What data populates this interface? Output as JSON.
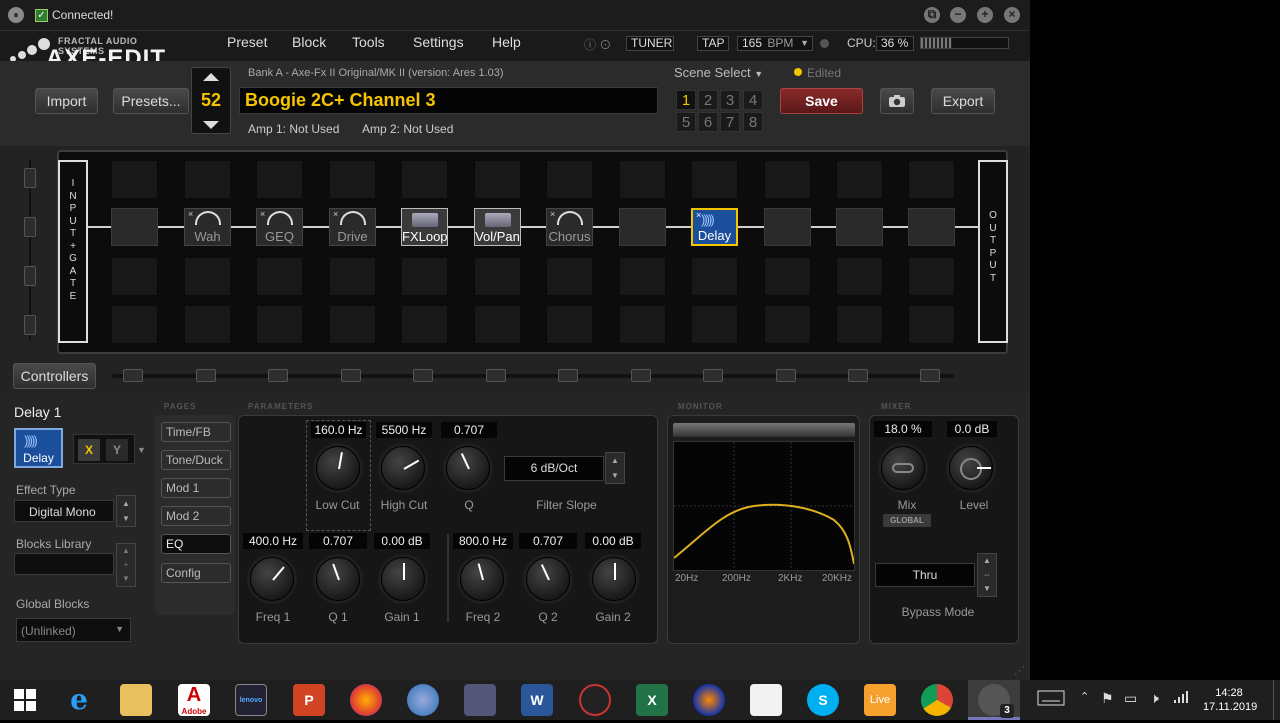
{
  "titlebar": {
    "status": "Connected!",
    "check": "✓",
    "pause_icon": "⏸",
    "restore_icon": "⧉",
    "minimize_icon": "−",
    "maximize_icon": "+",
    "close_icon": "×"
  },
  "logo": {
    "company": "FRACTAL AUDIO SYSTEMS",
    "product": "AXE-EDIT"
  },
  "menu": [
    "Preset",
    "Block",
    "Tools",
    "Settings",
    "Help"
  ],
  "header": {
    "tuner": "TUNER",
    "tap": "TAP",
    "bpm_value": "165",
    "bpm_unit": "BPM",
    "cpu_label": "CPU:",
    "cpu_value": "36 %",
    "cpu_fraction": 0.36
  },
  "toolbar": {
    "import": "Import",
    "presets": "Presets...",
    "save": "Save",
    "export": "Export",
    "preset_number": "52",
    "bank_info": "Bank A - Axe-Fx II Original/MK II (version: Ares 1.03)",
    "preset_name": "Boogie 2C+ Channel 3",
    "amp1": "Amp 1: Not Used",
    "amp2": "Amp 2: Not Used",
    "scene_select": "Scene Select",
    "edited": "Edited",
    "scenes": [
      "1",
      "2",
      "3",
      "4",
      "5",
      "6",
      "7",
      "8"
    ],
    "active_scene": "1",
    "camera_icon": "camera-icon"
  },
  "grid": {
    "input_label": [
      "I",
      "N",
      "P",
      "U",
      "T",
      "+",
      "G",
      "A",
      "T",
      "E"
    ],
    "output_label": [
      "O",
      "U",
      "T",
      "P",
      "U",
      "T"
    ],
    "blocks": [
      {
        "label": "Wah",
        "state": "bypass"
      },
      {
        "label": "GEQ",
        "state": "bypass"
      },
      {
        "label": "Drive",
        "state": "bypass"
      },
      {
        "label": "FXLoop",
        "state": "on"
      },
      {
        "label": "Vol/Pan",
        "state": "on"
      },
      {
        "label": "Chorus",
        "state": "bypass"
      },
      {
        "label": "Delay",
        "state": "selected"
      }
    ]
  },
  "controllers": {
    "label": "Controllers"
  },
  "block_panel": {
    "title": "Delay 1",
    "icon_label": "Delay",
    "x": "X",
    "y": "Y",
    "effect_type_label": "Effect Type",
    "effect_type": "Digital Mono",
    "blocks_library_label": "Blocks Library",
    "global_blocks_label": "Global Blocks",
    "global_blocks_value": "(Unlinked)"
  },
  "sections": {
    "pages": "PAGES",
    "parameters": "PARAMETERS",
    "monitor": "MONITOR",
    "mixer": "MIXER"
  },
  "pages": [
    "Time/FB",
    "Tone/Duck",
    "Mod 1",
    "Mod 2",
    "EQ",
    "Config"
  ],
  "active_page": "EQ",
  "params": {
    "low_cut": {
      "value": "160.0 Hz",
      "label": "Low Cut"
    },
    "high_cut": {
      "value": "5500 Hz",
      "label": "High Cut"
    },
    "q": {
      "value": "0.707",
      "label": "Q"
    },
    "filter_slope": {
      "value": "6 dB/Oct",
      "label": "Filter Slope"
    },
    "freq1": {
      "value": "400.0 Hz",
      "label": "Freq 1"
    },
    "q1": {
      "value": "0.707",
      "label": "Q 1"
    },
    "gain1": {
      "value": "0.00 dB",
      "label": "Gain 1"
    },
    "freq2": {
      "value": "800.0 Hz",
      "label": "Freq 2"
    },
    "q2": {
      "value": "0.707",
      "label": "Q 2"
    },
    "gain2": {
      "value": "0.00 dB",
      "label": "Gain 2"
    }
  },
  "monitor": {
    "axis": [
      "20Hz",
      "200Hz",
      "2KHz",
      "20KHz"
    ],
    "curve_color": "#e0b020"
  },
  "mixer": {
    "mix": {
      "value": "18.0 %",
      "label": "Mix",
      "badge": "GLOBAL"
    },
    "level": {
      "value": "0.0 dB",
      "label": "Level"
    },
    "bypass_mode": {
      "value": "Thru",
      "label": "Bypass Mode"
    }
  },
  "taskbar": {
    "apps": [
      "windows-start-icon",
      "internet-explorer-icon",
      "file-explorer-icon",
      "adobe-icon",
      "lenovo-icon",
      "powerpoint-icon",
      "firefox-icon",
      "thunderbird-icon",
      "network-app-icon",
      "word-icon",
      "guitar-pro-icon",
      "excel-icon",
      "audacity-icon",
      "blank-file-icon",
      "skype-icon",
      "live-icon",
      "chrome-icon",
      "axe-edit-icon"
    ],
    "adobe_label": "Adobe",
    "lenovo_label": "lenovo",
    "ppt_label": "P",
    "word_label": "W",
    "excel_label": "X",
    "skype_label": "S",
    "live_label": "Live",
    "axe_badge": "3",
    "time": "14:28",
    "date": "17.11.2019"
  },
  "colors": {
    "accent": "#f5c400",
    "save_button": "#6a2020",
    "delay_block": "#1b4f9c"
  }
}
